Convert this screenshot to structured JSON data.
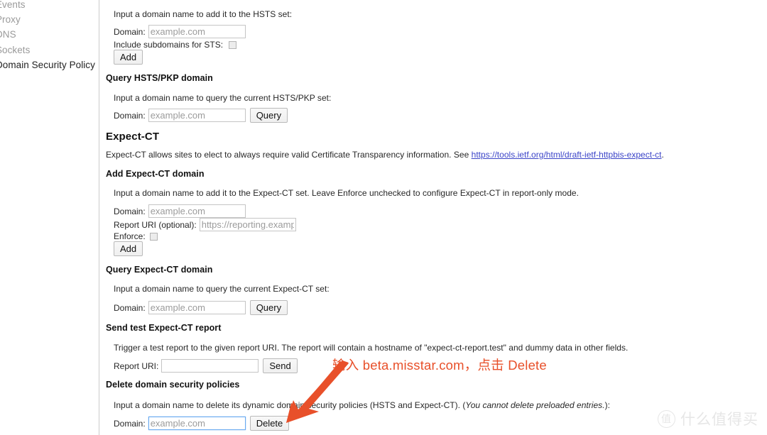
{
  "sidebar": {
    "items": [
      {
        "label": "Events",
        "selected": false
      },
      {
        "label": "Proxy",
        "selected": false
      },
      {
        "label": "DNS",
        "selected": false
      },
      {
        "label": "Sockets",
        "selected": false
      },
      {
        "label": "Domain Security Policy",
        "selected": true
      }
    ]
  },
  "hsts_add": {
    "description": "Input a domain name to add it to the HSTS set:",
    "domain_label": "Domain:",
    "domain_placeholder": "example.com",
    "domain_value": "",
    "subdomains_label": "Include subdomains for STS:",
    "subdomains_checked": false,
    "add_button": "Add"
  },
  "hsts_query": {
    "heading": "Query HSTS/PKP domain",
    "description": "Input a domain name to query the current HSTS/PKP set:",
    "domain_label": "Domain:",
    "domain_placeholder": "example.com",
    "domain_value": "",
    "query_button": "Query"
  },
  "expect_ct": {
    "heading": "Expect-CT",
    "description_before": "Expect-CT allows sites to elect to always require valid Certificate Transparency information. See ",
    "link_text": "https://tools.ietf.org/html/draft-ietf-httpbis-expect-ct",
    "description_after": "."
  },
  "expect_ct_add": {
    "heading": "Add Expect-CT domain",
    "description": "Input a domain name to add it to the Expect-CT set. Leave Enforce unchecked to configure Expect-CT in report-only mode.",
    "domain_label": "Domain:",
    "domain_placeholder": "example.com",
    "domain_value": "",
    "report_uri_label": "Report URI (optional):",
    "report_uri_placeholder": "https://reporting.example.com",
    "report_uri_value": "",
    "enforce_label": "Enforce:",
    "enforce_checked": false,
    "add_button": "Add"
  },
  "expect_ct_query": {
    "heading": "Query Expect-CT domain",
    "description": "Input a domain name to query the current Expect-CT set:",
    "domain_label": "Domain:",
    "domain_placeholder": "example.com",
    "domain_value": "",
    "query_button": "Query"
  },
  "expect_ct_test": {
    "heading": "Send test Expect-CT report",
    "description": "Trigger a test report to the given report URI. The report will contain a hostname of \"expect-ct-report.test\" and dummy data in other fields.",
    "report_uri_label": "Report URI:",
    "report_uri_placeholder": "",
    "report_uri_value": "",
    "send_button": "Send"
  },
  "delete_policies": {
    "heading": "Delete domain security policies",
    "description_before": "Input a domain name to delete its dynamic domain security policies (HSTS and Expect-CT). (",
    "description_italic": "You cannot delete preloaded entries.",
    "description_after": "):",
    "domain_label": "Domain:",
    "domain_placeholder": "example.com",
    "domain_value": "",
    "delete_button": "Delete",
    "focused": true
  },
  "annotation": {
    "text": "输入 beta.misstar.com，点击 Delete",
    "color": "#e8502a"
  },
  "watermark": {
    "badge": "值",
    "text": "什么值得买"
  }
}
